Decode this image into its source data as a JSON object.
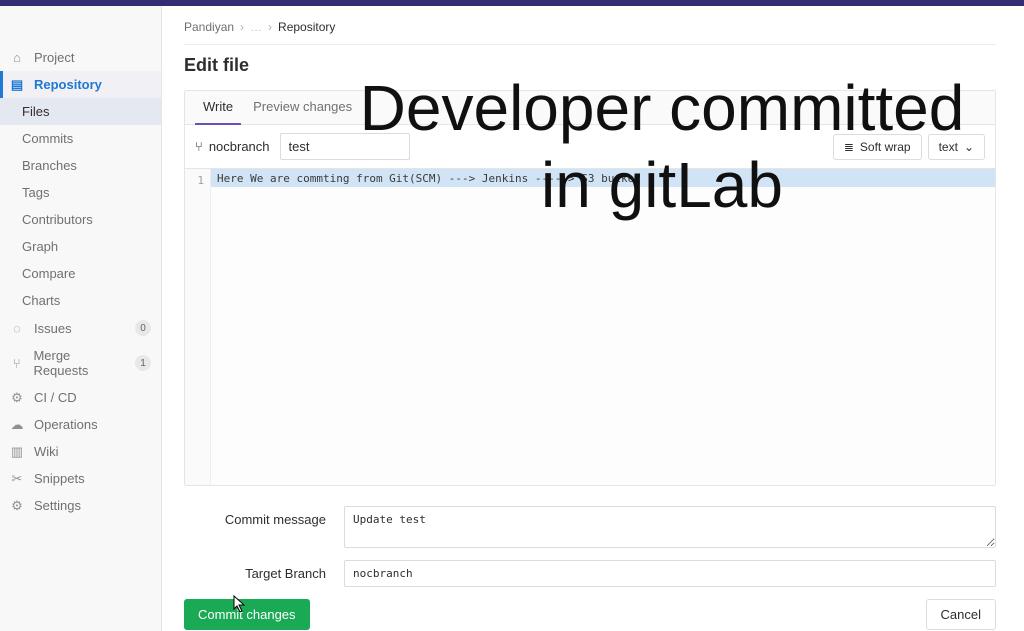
{
  "breadcrumb": {
    "root": "Pandiyan",
    "current": "Repository"
  },
  "page_title": "Edit file",
  "sidebar": {
    "items": [
      {
        "label": "Project",
        "icon": "home-icon"
      },
      {
        "label": "Repository",
        "icon": "file-icon",
        "active": true
      },
      {
        "label": "Issues",
        "icon": "issues-icon",
        "badge": "0"
      },
      {
        "label": "Merge Requests",
        "icon": "merge-icon",
        "badge": "1"
      },
      {
        "label": "CI / CD",
        "icon": "ci-icon"
      },
      {
        "label": "Operations",
        "icon": "ops-icon"
      },
      {
        "label": "Wiki",
        "icon": "wiki-icon"
      },
      {
        "label": "Snippets",
        "icon": "snippets-icon"
      },
      {
        "label": "Settings",
        "icon": "settings-icon"
      }
    ],
    "repo_sub": [
      {
        "label": "Files",
        "active": true
      },
      {
        "label": "Commits"
      },
      {
        "label": "Branches"
      },
      {
        "label": "Tags"
      },
      {
        "label": "Contributors"
      },
      {
        "label": "Graph"
      },
      {
        "label": "Compare"
      },
      {
        "label": "Charts"
      }
    ]
  },
  "editor": {
    "tabs": {
      "write": "Write",
      "preview": "Preview changes"
    },
    "branch": "nocbranch",
    "filename": "test",
    "soft_wrap": "Soft wrap",
    "text_dropdown": "text",
    "gutter_line1": "1",
    "code_line1": "Here We are commting from Git(SCM) ---> Jenkins -----> S3 bucket"
  },
  "form": {
    "commit_label": "Commit message",
    "commit_value": "Update test",
    "branch_label": "Target Branch",
    "branch_value": "nocbranch",
    "commit_button": "Commit changes",
    "cancel_button": "Cancel"
  },
  "overlay": "Developer committed in gitLab",
  "icons": {
    "branch_glyph": "⑂",
    "wrap_glyph": "≣",
    "chevron_down": "⌄"
  }
}
